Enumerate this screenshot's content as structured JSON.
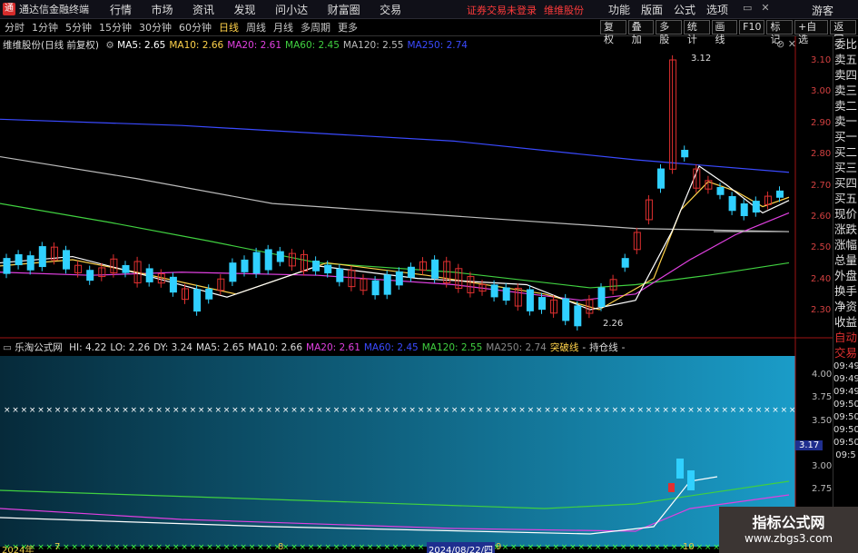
{
  "app": {
    "title": "通达信金融终端",
    "logo": "通"
  },
  "menu": [
    "行情",
    "市场",
    "资讯",
    "发现",
    "问小达",
    "财富圈",
    "交易"
  ],
  "warn": [
    "证券交易未登录",
    "维维股份"
  ],
  "right_menu": [
    "功能",
    "版面",
    "公式",
    "选项"
  ],
  "guest": "游客",
  "toolbar": {
    "periods": [
      "分时",
      "1分钟",
      "5分钟",
      "15分钟",
      "30分钟",
      "60分钟",
      "日线",
      "周线",
      "月线",
      "多周期",
      "更多"
    ],
    "active": "日线",
    "buttons": [
      "复权",
      "叠加",
      "多股",
      "统计",
      "画线",
      "F10",
      "标记",
      "+自选",
      "返回"
    ]
  },
  "main_legend": {
    "name": "维维股份(日线 前复权)",
    "items": [
      {
        "label": "MA5: 2.65",
        "color": "#ffffff"
      },
      {
        "label": "MA10: 2.66",
        "color": "#ffd24a"
      },
      {
        "label": "MA20: 2.61",
        "color": "#e040e0"
      },
      {
        "label": "MA60: 2.45",
        "color": "#40d040"
      },
      {
        "label": "MA120: 2.55",
        "color": "#bbbbbb"
      },
      {
        "label": "MA250: 2.74",
        "color": "#3a4aff"
      }
    ]
  },
  "sub_legend": {
    "name": "乐淘公式网",
    "items": [
      {
        "label": "HI: 4.22",
        "color": "#dddddd"
      },
      {
        "label": "LO: 2.26",
        "color": "#dddddd"
      },
      {
        "label": "DY: 3.24",
        "color": "#dddddd"
      },
      {
        "label": "MA5: 2.65",
        "color": "#dddddd"
      },
      {
        "label": "MA10: 2.66",
        "color": "#dddddd"
      },
      {
        "label": "MA20: 2.61",
        "color": "#e040e0"
      },
      {
        "label": "MA60: 2.45",
        "color": "#3a4aff"
      },
      {
        "label": "MA120: 2.55",
        "color": "#40d040"
      },
      {
        "label": "MA250: 2.74",
        "color": "#888888"
      },
      {
        "label": "突破线",
        "color": "#ffd24a"
      },
      {
        "label": "-",
        "color": "#dddddd"
      },
      {
        "label": "持仓线",
        "color": "#dddddd"
      },
      {
        "label": "-",
        "color": "#dddddd"
      }
    ]
  },
  "price_axis": [
    "3.10",
    "3.00",
    "2.90",
    "2.80",
    "2.70",
    "2.60",
    "2.50",
    "2.40",
    "2.30"
  ],
  "sub_axis": [
    "4.00",
    "3.75",
    "3.50",
    "3.17",
    "3.00",
    "2.75"
  ],
  "annotations": {
    "high": "3.12",
    "low": "2.26"
  },
  "x_labels": [
    "2024年",
    "7",
    "8",
    "2024/08/22/四",
    "9",
    "10"
  ],
  "right_panel": [
    "委比",
    "卖五",
    "卖四",
    "卖三",
    "卖二",
    "卖一",
    "买一",
    "买二",
    "买三",
    "买四",
    "买五",
    "现价",
    "涨跌",
    "涨幅",
    "总量",
    "外盘",
    "换手",
    "净资",
    "收益",
    "自动",
    "交易",
    "09:49",
    "09:49",
    "09:49",
    "09:50",
    "09:50",
    "09:50",
    "09:50",
    "09:5"
  ],
  "watermark": {
    "line1": "指标公式网",
    "line2": "www.zbgs3.com"
  },
  "colors": {
    "up": "#e03030",
    "down": "#30d0ff",
    "ma250": "#3a4aff",
    "ma120": "#bbbbbb",
    "ma60": "#40d040",
    "ma20": "#e040e0",
    "ma10": "#ffd24a",
    "ma5": "#ffffff"
  }
}
